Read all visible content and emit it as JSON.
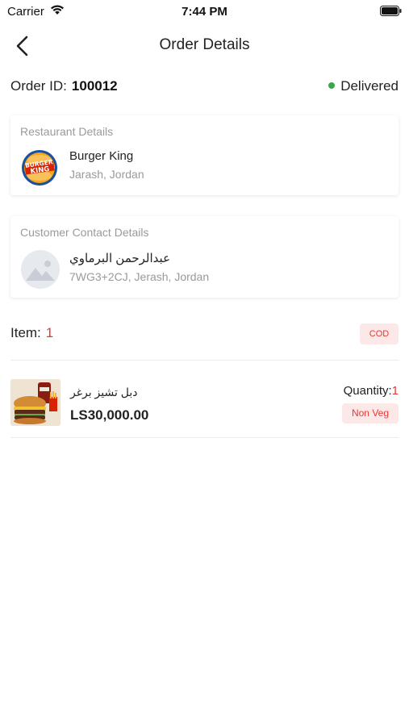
{
  "status_bar": {
    "carrier": "Carrier",
    "time": "7:44 PM"
  },
  "header": {
    "title": "Order Details"
  },
  "order": {
    "label": "Order ID:",
    "id": "100012",
    "status": "Delivered",
    "status_color": "#3aa84a"
  },
  "restaurant": {
    "section_title": "Restaurant Details",
    "name": "Burger King",
    "location": "Jarash, Jordan",
    "logo_icon": "burger-king-logo"
  },
  "customer": {
    "section_title": "Customer Contact Details",
    "name": "عبدالرحمن البرماوي",
    "address": "7WG3+2CJ, Jerash, Jordan",
    "avatar_icon": "image-placeholder-icon"
  },
  "items_summary": {
    "label": "Item:",
    "count": "1",
    "payment_badge": "COD"
  },
  "items": [
    {
      "name": "دبل تشيز برغر",
      "price": "LS30,000.00",
      "quantity_label": "Quantity:",
      "quantity": "1",
      "tag": "Non Veg",
      "image_icon": "burger-meal-image"
    }
  ],
  "colors": {
    "accent": "#e53935",
    "badge_bg": "#fde8e8",
    "muted": "#9a9a9a"
  }
}
